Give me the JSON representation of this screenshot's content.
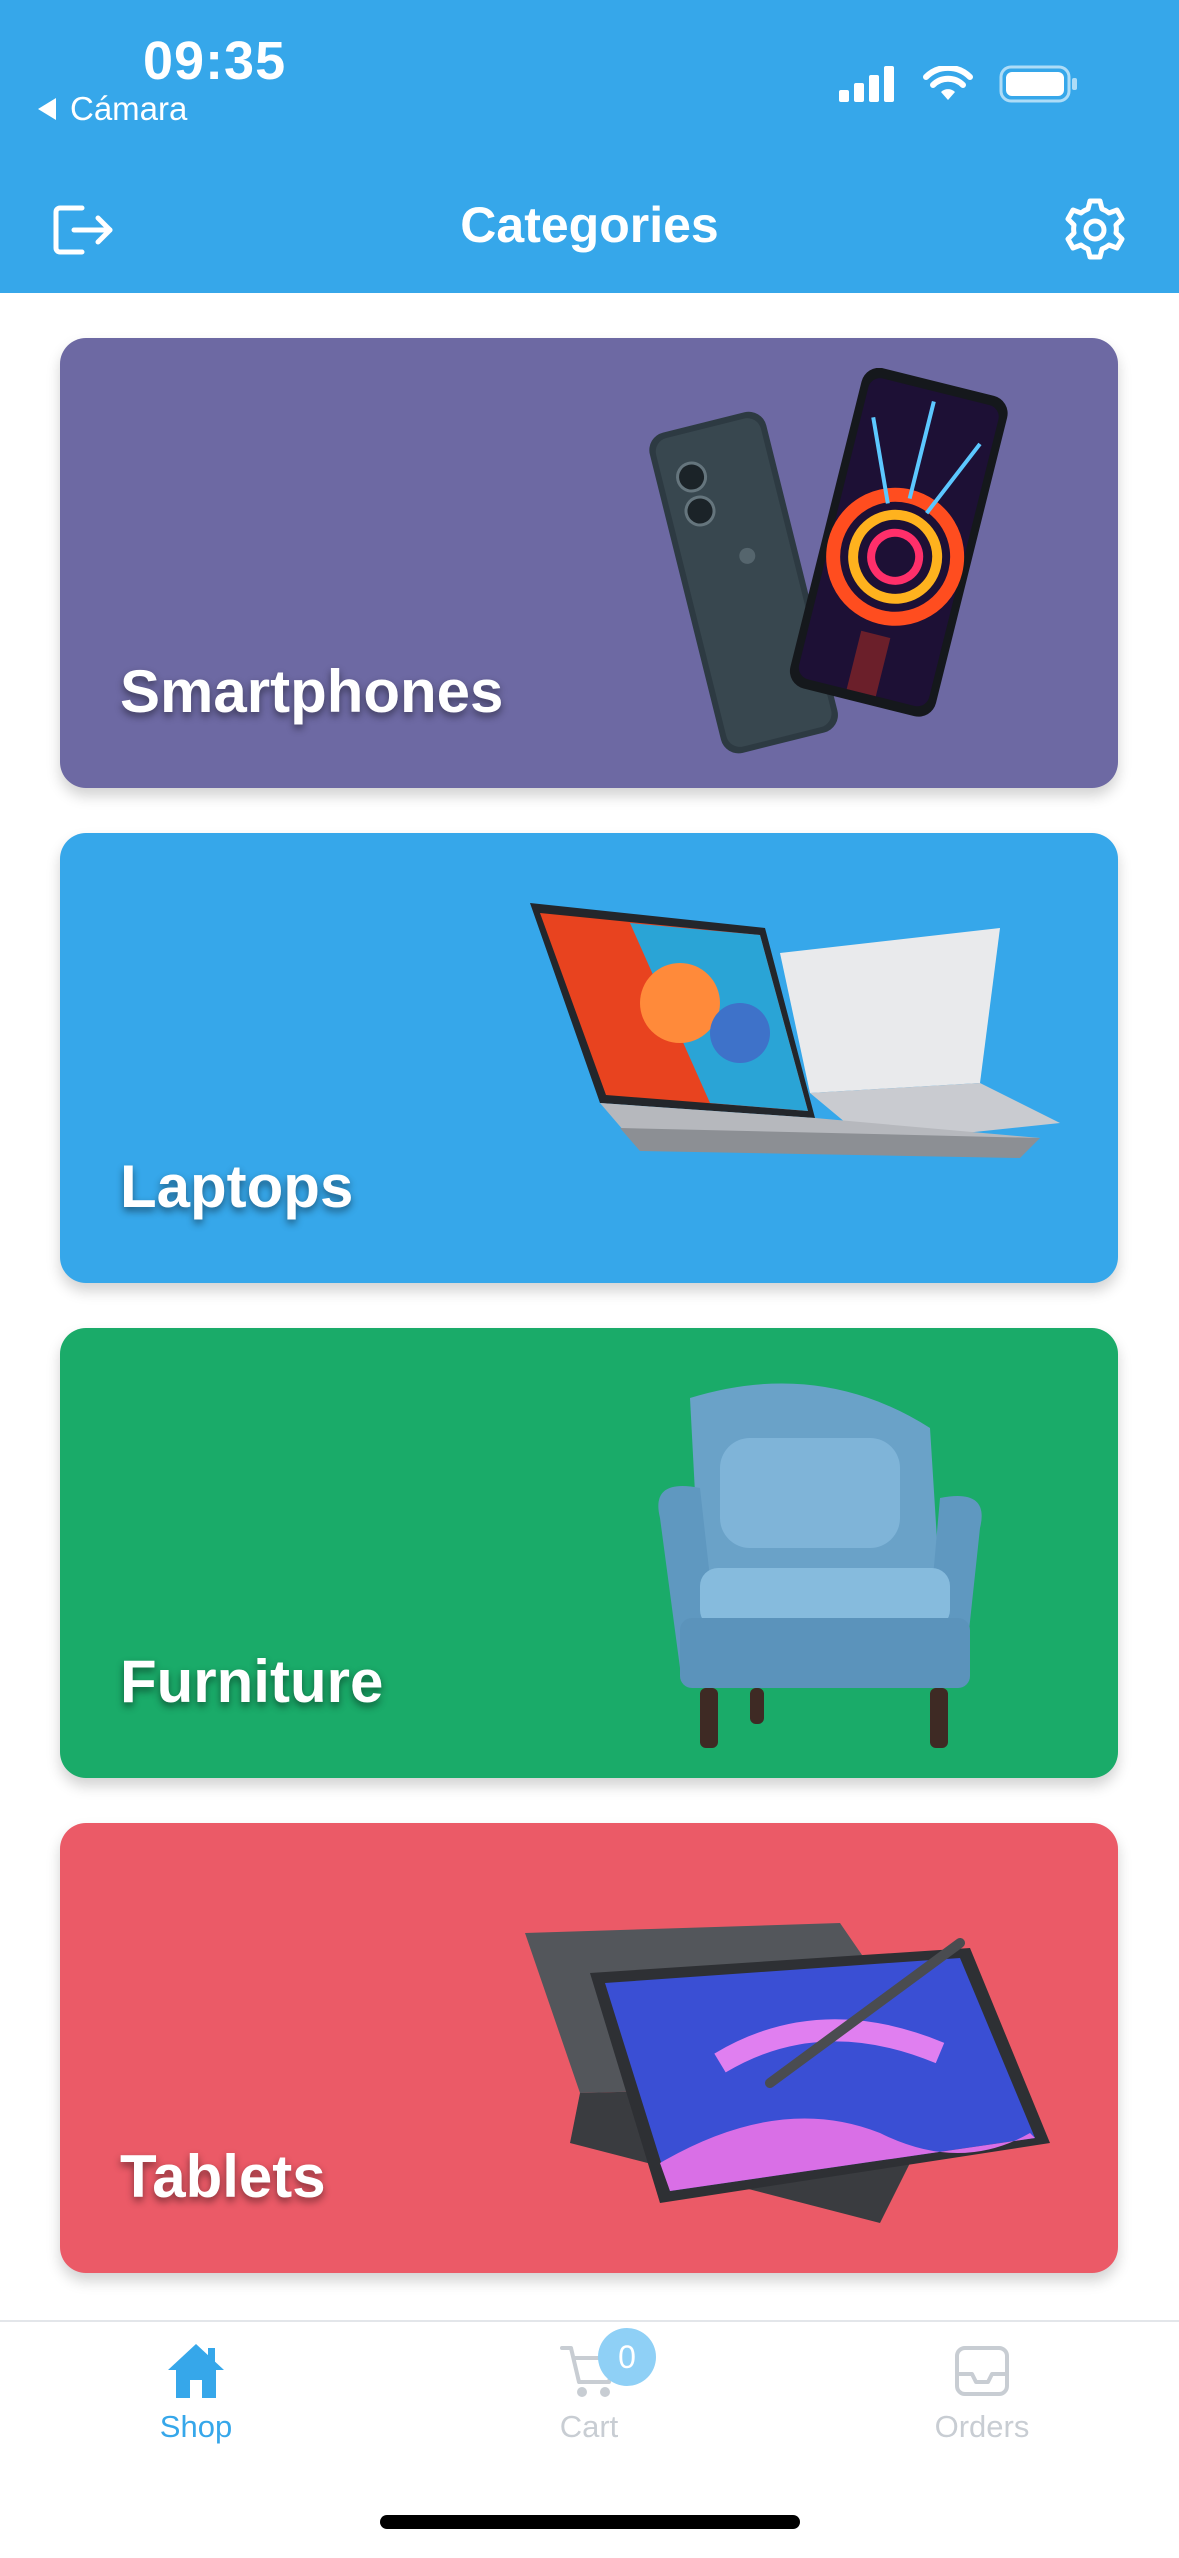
{
  "status_bar": {
    "time": "09:35",
    "back_app": "Cámara"
  },
  "header": {
    "title": "Categories",
    "left_icon": "logout-icon",
    "right_icon": "gear-icon",
    "background": "#36a7ea"
  },
  "categories": [
    {
      "label": "Smartphones",
      "color": "#6d69a3",
      "image": "smartphones-image"
    },
    {
      "label": "Laptops",
      "color": "#36a7ea",
      "image": "laptops-image"
    },
    {
      "label": "Furniture",
      "color": "#1aab69",
      "image": "armchair-image"
    },
    {
      "label": "Tablets",
      "color": "#eb5a67",
      "image": "tablet-image"
    }
  ],
  "tabbar": {
    "tabs": [
      {
        "label": "Shop",
        "icon": "home-icon",
        "active": true,
        "color": "#36a7ea"
      },
      {
        "label": "Cart",
        "icon": "cart-icon",
        "active": false,
        "color": "#c8cdd3"
      },
      {
        "label": "Orders",
        "icon": "inbox-icon",
        "active": false,
        "color": "#c8cdd3"
      }
    ],
    "cart_badge": "0"
  }
}
